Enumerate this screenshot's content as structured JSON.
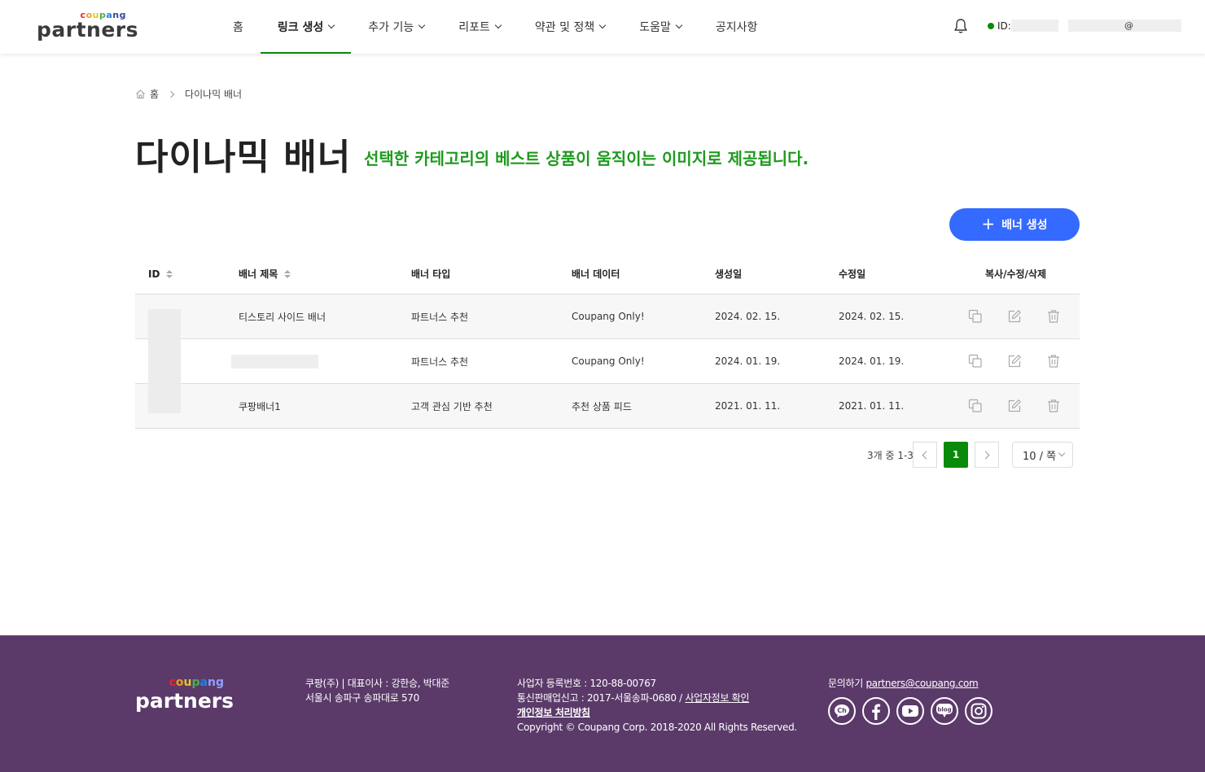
{
  "header": {
    "logo_small": "coupang",
    "logo_big": "partners",
    "nav": [
      {
        "label": "홈",
        "dropdown": false,
        "active": false
      },
      {
        "label": "링크 생성",
        "dropdown": true,
        "active": true
      },
      {
        "label": "추가 기능",
        "dropdown": true,
        "active": false
      },
      {
        "label": "리포트",
        "dropdown": true,
        "active": false
      },
      {
        "label": "약관 및 정책",
        "dropdown": true,
        "active": false
      },
      {
        "label": "도움말",
        "dropdown": true,
        "active": false
      },
      {
        "label": "공지사항",
        "dropdown": false,
        "active": false
      }
    ],
    "id_label": "ID:",
    "email_at": "@",
    "status_color": "#0a8a0a"
  },
  "breadcrumb": {
    "home": "홈",
    "current": "다이나믹 배너"
  },
  "page": {
    "title": "다이나믹 배너",
    "description": "선택한 카테고리의 베스트 상품이 움직이는 이미지로 제공됩니다.",
    "create_button": "배너 생성",
    "create_button_color": "#346aff"
  },
  "table": {
    "headers": {
      "id": "ID",
      "title": "배너 제목",
      "type": "배너 타입",
      "data": "배너 데이터",
      "created": "생성일",
      "modified": "수정일",
      "actions": "복사/수정/삭제"
    },
    "rows": [
      {
        "title": "티스토리 사이드 배너",
        "type": "파트너스 추천",
        "data": "Coupang Only!",
        "created": "2024. 02. 15.",
        "modified": "2024. 02. 15."
      },
      {
        "title": "",
        "type": "파트너스 추천",
        "data": "Coupang Only!",
        "created": "2024. 01. 19.",
        "modified": "2024. 01. 19."
      },
      {
        "title": "쿠팡배너1",
        "type": "고객 관심 기반 추천",
        "data": "추천 상품 피드",
        "created": "2021. 01. 11.",
        "modified": "2021. 01. 11."
      }
    ]
  },
  "pagination": {
    "info": "3개 중 1-3",
    "current": "1",
    "per_page": "10 / 쪽"
  },
  "footer": {
    "logo_small": "coupang",
    "logo_big": "partners",
    "company_line1": "쿠팡(주) | 대표이사 : 강한승, 박대준",
    "company_line2": "서울시 송파구 송파대로 570",
    "biz_reg": "사업자 등록번호 : 120-88-00767",
    "telecom": "통신판매업신고 : 2017-서울송파-0680 / ",
    "biz_info_link": "사업자정보 확인",
    "privacy": "개인정보 처리방침",
    "copyright": "Copyright © Coupang Corp. 2018-2020 All Rights Reserved.",
    "contact_label": "문의하기 ",
    "contact_email": "partners@coupang.com",
    "social": [
      "kakao-channel-icon",
      "facebook-icon",
      "youtube-icon",
      "blog-icon",
      "instagram-icon"
    ],
    "social_labels": {
      "kakao": "Ch",
      "blog": "blog"
    },
    "bg_color": "#5b3a6a"
  }
}
